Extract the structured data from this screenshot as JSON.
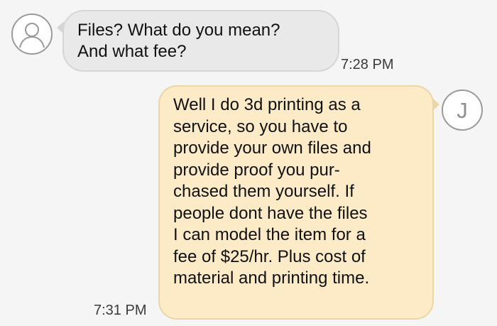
{
  "conversation": {
    "messages": [
      {
        "direction": "incoming",
        "avatar_icon": "person-silhouette-icon",
        "text": "Files? What do you mean?\nAnd what fee?",
        "time": "7:28 PM"
      },
      {
        "direction": "outgoing",
        "avatar_initial": "J",
        "text": "Well I do 3d printing as a\nservice, so you have to\nprovide your own files and\nprovide proof you pur-\nchased them yourself. If\npeople dont have the files\nI can model the item for a\nfee of $25/hr. Plus cost of\nmaterial and printing time.",
        "time": "7:31 PM"
      }
    ]
  },
  "colors": {
    "background": "#f5f5f5",
    "incoming_bubble": "#e9e9e9",
    "outgoing_bubble": "#fcebc6",
    "text": "#111111"
  }
}
